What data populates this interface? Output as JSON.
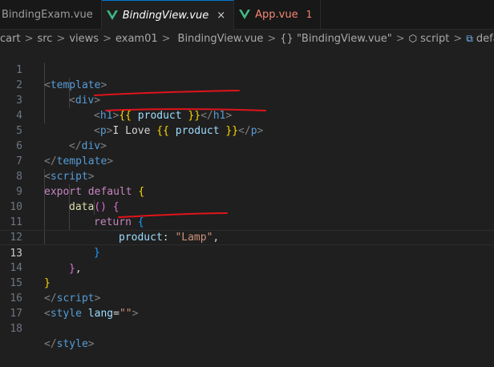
{
  "tabs": [
    {
      "label": "BindingExam.vue",
      "active": false
    },
    {
      "label": "BindingView.vue",
      "active": true,
      "close": "×"
    },
    {
      "label": "App.vue",
      "active": false,
      "badge": "1"
    }
  ],
  "breadcrumb": {
    "parts": [
      "cart",
      "src",
      "views",
      "exam01",
      "BindingView.vue",
      "{} \"BindingView.vue\"",
      "script",
      "default"
    ],
    "separator": ">"
  },
  "code": {
    "current_line": 13,
    "line_numbers": [
      "1",
      "2",
      "3",
      "4",
      "5",
      "6",
      "7",
      "8",
      "9",
      "10",
      "11",
      "12",
      "13",
      "14",
      "15",
      "16",
      "17",
      "18"
    ],
    "l1": {
      "open": "<",
      "tag": "template",
      "close": ">"
    },
    "l2": {
      "open": "<",
      "tag": "div",
      "close": ">"
    },
    "l3": {
      "open": "<",
      "tag": "h1",
      "close": ">",
      "mus_open": "{{",
      "expr": " product ",
      "mus_close": "}}",
      "end_open": "</",
      "end_close": ">"
    },
    "l4": {
      "open": "<",
      "tag": "p",
      "close": ">",
      "text": "I Love ",
      "mus_open": "{{",
      "expr": " product ",
      "mus_close": "}}",
      "end_open": "</",
      "end_close": ">"
    },
    "l5": {
      "open": "</",
      "tag": "div",
      "close": ">"
    },
    "l6": {
      "open": "</",
      "tag": "template",
      "close": ">"
    },
    "l7": {
      "open": "<",
      "tag": "script",
      "close": ">"
    },
    "l8": {
      "kw_export": "export",
      "kw_default": " default ",
      "brace": "{"
    },
    "l9": {
      "fn": "data",
      "parens": "() ",
      "brace": "{"
    },
    "l10": {
      "kw": "return",
      "brace": " {"
    },
    "l11": {
      "key": "product",
      "colon": ": ",
      "value": "\"Lamp\"",
      "comma": ","
    },
    "l12": {
      "brace": "}"
    },
    "l13": {
      "brace": "}",
      "comma": ","
    },
    "l14": {
      "brace": "}"
    },
    "l15": {
      "open": "</",
      "tag": "script",
      "close": ">"
    },
    "l16": {
      "open": "<",
      "tag": "style",
      "attr": " lang",
      "eq": "=",
      "value": "\"\"",
      "close": ">"
    },
    "l18": {
      "open": "</",
      "tag": "style",
      "close": ">"
    }
  },
  "colors": {
    "vue_icon": "#41b883",
    "annotation": "#e0141b",
    "accent": "#0078d4"
  }
}
